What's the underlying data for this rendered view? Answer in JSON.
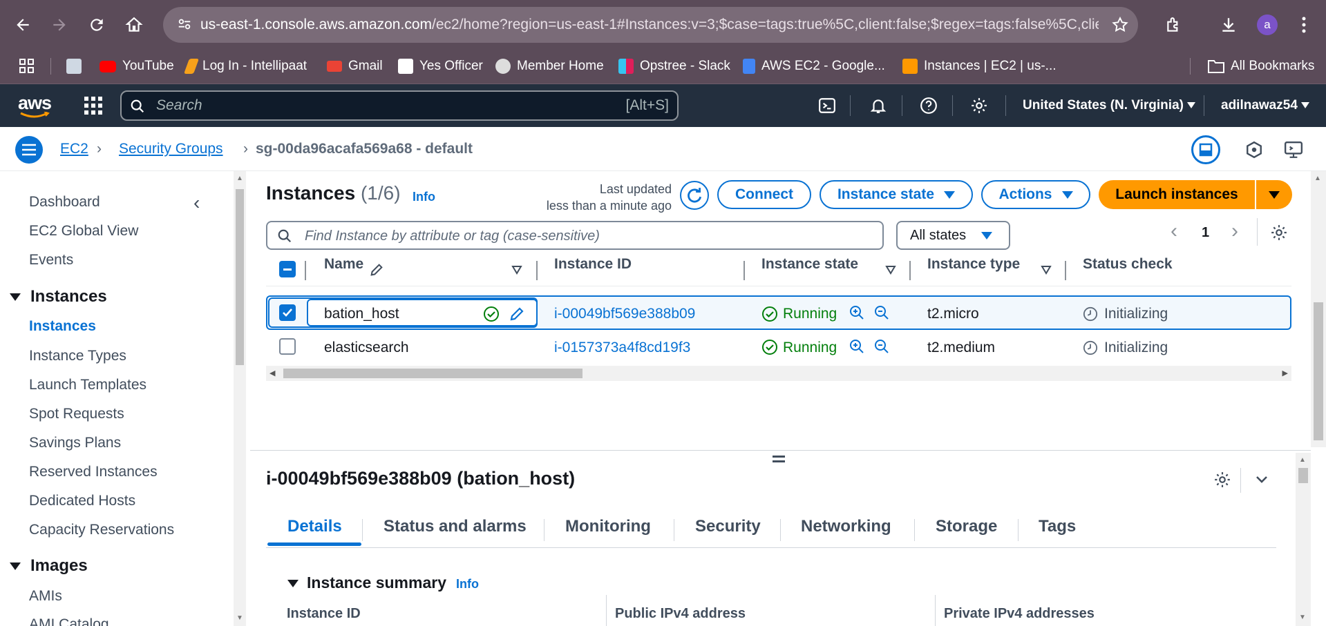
{
  "browser": {
    "url_host": "us-east-1.console.aws.amazon.com",
    "url_rest": "/ec2/home?region=us-east-1#Instances:v=3;$case=tags:true%5C,client:false;$regex=tags:false%5C,clien...",
    "profile_initial": "a",
    "bookmarks": [
      {
        "label": "YouTube",
        "color": "#ff0000"
      },
      {
        "label": "Log In - Intellipaat",
        "color": "#f7a11a"
      },
      {
        "label": "Gmail",
        "color": "#ea4335"
      },
      {
        "label": "Yes Officer",
        "color": "#ffffff"
      },
      {
        "label": "Member Home",
        "color": "#dddddd"
      },
      {
        "label": "Opstree - Slack",
        "color": "#e01e5a"
      },
      {
        "label": "AWS EC2 - Google...",
        "color": "#4285f4"
      },
      {
        "label": "Instances | EC2 | us-...",
        "color": "#ff9900"
      }
    ],
    "all_bookmarks": "All Bookmarks"
  },
  "aws": {
    "logo": "aws",
    "search_placeholder": "Search",
    "search_shortcut": "[Alt+S]",
    "region": "United States (N. Virginia)",
    "user": "adilnawaz54"
  },
  "breadcrumb": {
    "items": [
      "EC2",
      "Security Groups"
    ],
    "current": "sg-00da96acafa569a68 - default"
  },
  "sidebar": {
    "items_top": [
      "Dashboard",
      "EC2 Global View",
      "Events"
    ],
    "section_instances": "Instances",
    "instances_items": [
      "Instances",
      "Instance Types",
      "Launch Templates",
      "Spot Requests",
      "Savings Plans",
      "Reserved Instances",
      "Dedicated Hosts",
      "Capacity Reservations"
    ],
    "section_images": "Images",
    "images_items": [
      "AMIs",
      "AMI Catalog"
    ]
  },
  "instances": {
    "title": "Instances",
    "count": "(1/6)",
    "info": "Info",
    "last_updated_1": "Last updated",
    "last_updated_2": "less than a minute ago",
    "connect": "Connect",
    "instance_state": "Instance state",
    "actions": "Actions",
    "launch": "Launch instances",
    "filter_placeholder": "Find Instance by attribute or tag (case-sensitive)",
    "states": "All states",
    "page": "1",
    "columns": [
      "Name",
      "Instance ID",
      "Instance state",
      "Instance type",
      "Status check"
    ],
    "rows": [
      {
        "name": "bation_host",
        "id": "i-00049bf569e388b09",
        "state": "Running",
        "type": "t2.micro",
        "status": "Initializing",
        "selected": true
      },
      {
        "name": "elasticsearch",
        "id": "i-0157373a4f8cd19f3",
        "state": "Running",
        "type": "t2.medium",
        "status": "Initializing",
        "selected": false
      }
    ]
  },
  "detail": {
    "title": "i-00049bf569e388b09 (bation_host)",
    "tabs": [
      "Details",
      "Status and alarms",
      "Monitoring",
      "Security",
      "Networking",
      "Storage",
      "Tags"
    ],
    "summary": "Instance summary",
    "info": "Info",
    "fields": [
      "Instance ID",
      "Public IPv4 address",
      "Private IPv4 addresses"
    ]
  }
}
